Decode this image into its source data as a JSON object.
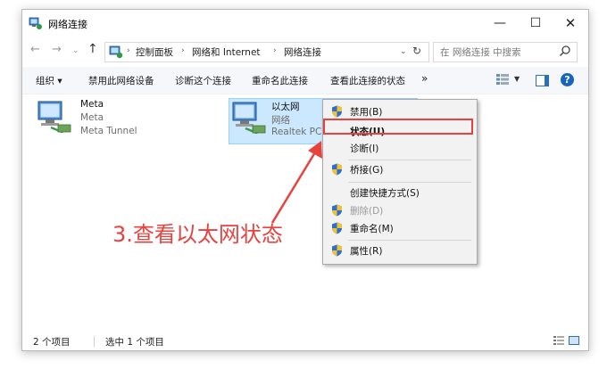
{
  "window": {
    "title": "网络连接",
    "minimize_glyph": "—",
    "maximize_glyph": "☐",
    "close_glyph": "✕"
  },
  "address": {
    "back_glyph": "←",
    "forward_glyph": "→",
    "history_glyph": "⌄",
    "up_glyph": "↑",
    "breadcrumb": [
      "控制面板",
      "网络和 Internet",
      "网络连接"
    ],
    "separator": "›",
    "dropdown_glyph": "⌄",
    "refresh_glyph": "↻"
  },
  "search": {
    "placeholder": "在 网络连接 中搜索"
  },
  "toolbar": {
    "organize": "组织 ▾",
    "disable": "禁用此网络设备",
    "diagnose": "诊断这个连接",
    "rename": "重命名此连接",
    "view_status": "查看此连接的状态",
    "more": "»",
    "view_dropdown": "▼",
    "help": "?"
  },
  "connections": [
    {
      "name": "Meta",
      "status": "Meta",
      "device": "Meta Tunnel"
    },
    {
      "name": "以太网",
      "status": "网络",
      "device": "Realtek PCI"
    }
  ],
  "context_menu": {
    "items": [
      {
        "label": "禁用(B)",
        "shield": true
      },
      {
        "label": "状态(U)",
        "bold": true
      },
      {
        "label": "诊断(I)"
      },
      {
        "label": "桥接(G)",
        "shield": true
      },
      {
        "label": "创建快捷方式(S)"
      },
      {
        "label": "删除(D)",
        "shield": true,
        "disabled": true
      },
      {
        "label": "重命名(M)",
        "shield": true
      },
      {
        "label": "属性(R)",
        "shield": true
      }
    ]
  },
  "status_bar": {
    "item_count": "2 个项目",
    "selected": "选中 1 个项目"
  },
  "annotation": {
    "text": "3.查看以太网状态",
    "color": "#e8423f"
  },
  "colors": {
    "selection": "#cce8ff",
    "accent": "#1565c0"
  }
}
